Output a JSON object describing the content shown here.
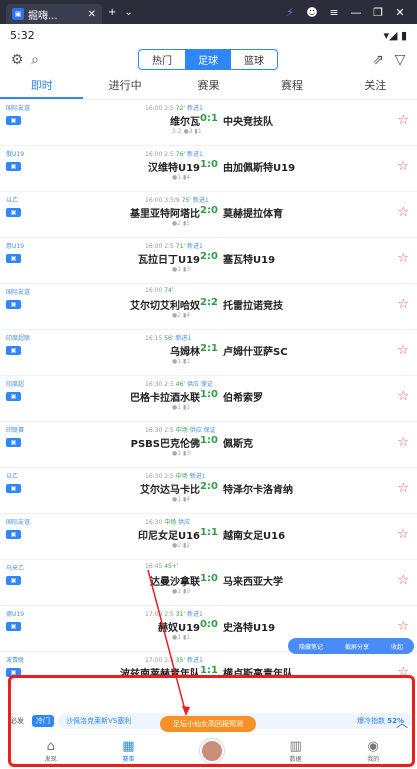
{
  "window": {
    "tab_title": "掘嗨...",
    "app_icon": "app-icon"
  },
  "status": {
    "time": "5:32",
    "right": "▾◢ ▮"
  },
  "top": {
    "segments": [
      "热门",
      "足球",
      "篮球"
    ],
    "active": 1
  },
  "tabs": [
    "即时",
    "进行中",
    "赛果",
    "赛程",
    "关注"
  ],
  "matches": [
    {
      "league": "国际友谊",
      "time": "16:00",
      "half": "2:5",
      "min": "72'",
      "tag": "新进1",
      "home": "维尔瓦",
      "score": "0:1",
      "away": "中央竞技队",
      "sub": "5:2  ●3  ▮1"
    },
    {
      "league": "俄U19",
      "time": "16:00",
      "half": "2:5",
      "min": "76'",
      "tag": "新进1",
      "home": "汉维特U19",
      "score": "1:0",
      "away": "由加佩斯特U19",
      "sub": "●1  ▮4"
    },
    {
      "league": "以乙",
      "time": "16:00",
      "half": "3:5/9",
      "min": "75'",
      "tag": "新进1",
      "home": "基里亚特阿塔比",
      "score": "2:0",
      "away": "莫赫提拉体育",
      "sub": "●2  ▮5"
    },
    {
      "league": "意U19",
      "time": "16:00",
      "half": "2:5",
      "min": "71'",
      "tag": "新进1",
      "home": "瓦拉日丁U19",
      "score": "2:0",
      "away": "塞瓦特U19",
      "sub": "●1  ▮3"
    },
    {
      "league": "国际友谊",
      "time": "16:00",
      "half": "",
      "min": "74'",
      "tag": "",
      "home": "艾尔切艾利哈奴",
      "score": "2:2",
      "away": "托雷拉诺竞技",
      "sub": "●2  ▮4"
    },
    {
      "league": "印度超联",
      "time": "16:15",
      "half": "",
      "min": "56'",
      "tag": "新进1",
      "home": "乌姆林",
      "score": "2:1",
      "away": "卢姆什亚萨SC",
      "sub": "●1  ▮1"
    },
    {
      "league": "印度超",
      "time": "16:30",
      "half": "2:5",
      "min": "46'",
      "tag": "供应 保证",
      "home": "巴格卡拉酒水联",
      "score": "1:0",
      "away": "伯希索罗",
      "sub": "●1  ▮1"
    },
    {
      "league": "印联赛",
      "time": "16:30",
      "half": "2:5",
      "min": "中场",
      "tag": "供应 保证",
      "home": "PSBS巴克伦佛",
      "score": "1:0",
      "away": "佩斯克",
      "sub": "●1  ▮3"
    },
    {
      "league": "以乙",
      "time": "16:30",
      "half": "2:5",
      "min": "中场",
      "tag": "新进1",
      "home": "艾尔达马卡比",
      "score": "2:0",
      "away": "特泽尔卡洛肯纳",
      "sub": "●1  ▮4"
    },
    {
      "league": "国际友谊",
      "time": "16:30",
      "half": "",
      "min": "中场",
      "tag": "供应",
      "home": "印尼女足U16",
      "score": "1:1",
      "away": "越南女足U16",
      "sub": "●2  ▮2"
    },
    {
      "league": "马来乙",
      "time": "16:45",
      "half": "",
      "min": "45+'",
      "tag": "",
      "home": "达曼沙拿联",
      "score": "1:0",
      "away": "马来西亚大学",
      "sub": "●1  ▮3"
    },
    {
      "league": "德U19",
      "time": "17:00",
      "half": "2:5",
      "min": "31'",
      "tag": "新进1",
      "home": "赫奴U19",
      "score": "0:0",
      "away": "史洛特U19",
      "sub": "●1  ▮1"
    },
    {
      "league": "波青联",
      "time": "17:00",
      "half": "2:5",
      "min": "35'",
      "tag": "新进1",
      "home": "波兹南莱赫青年队",
      "score": "1:1",
      "away": "横卢斯高青年队",
      "sub": "●2  ▮1"
    }
  ],
  "float_bar": {
    "a": "隐藏笔记",
    "b": "截屏分享",
    "c": "收起"
  },
  "rec": {
    "label": "必发",
    "tag": "冷门",
    "text": "沙佩洛克莱斯VS塞利",
    "index": "爆冷指数",
    "pct": "52%"
  },
  "orange_label": "足坛小仙女高回报预测",
  "bottom_nav": [
    "发现",
    "赛事",
    "",
    "数据",
    "我的"
  ],
  "colors": {
    "accent": "#2f86f6",
    "score": "#2f9e44",
    "star": "#f05d5d",
    "highlight": "#e8211f"
  }
}
